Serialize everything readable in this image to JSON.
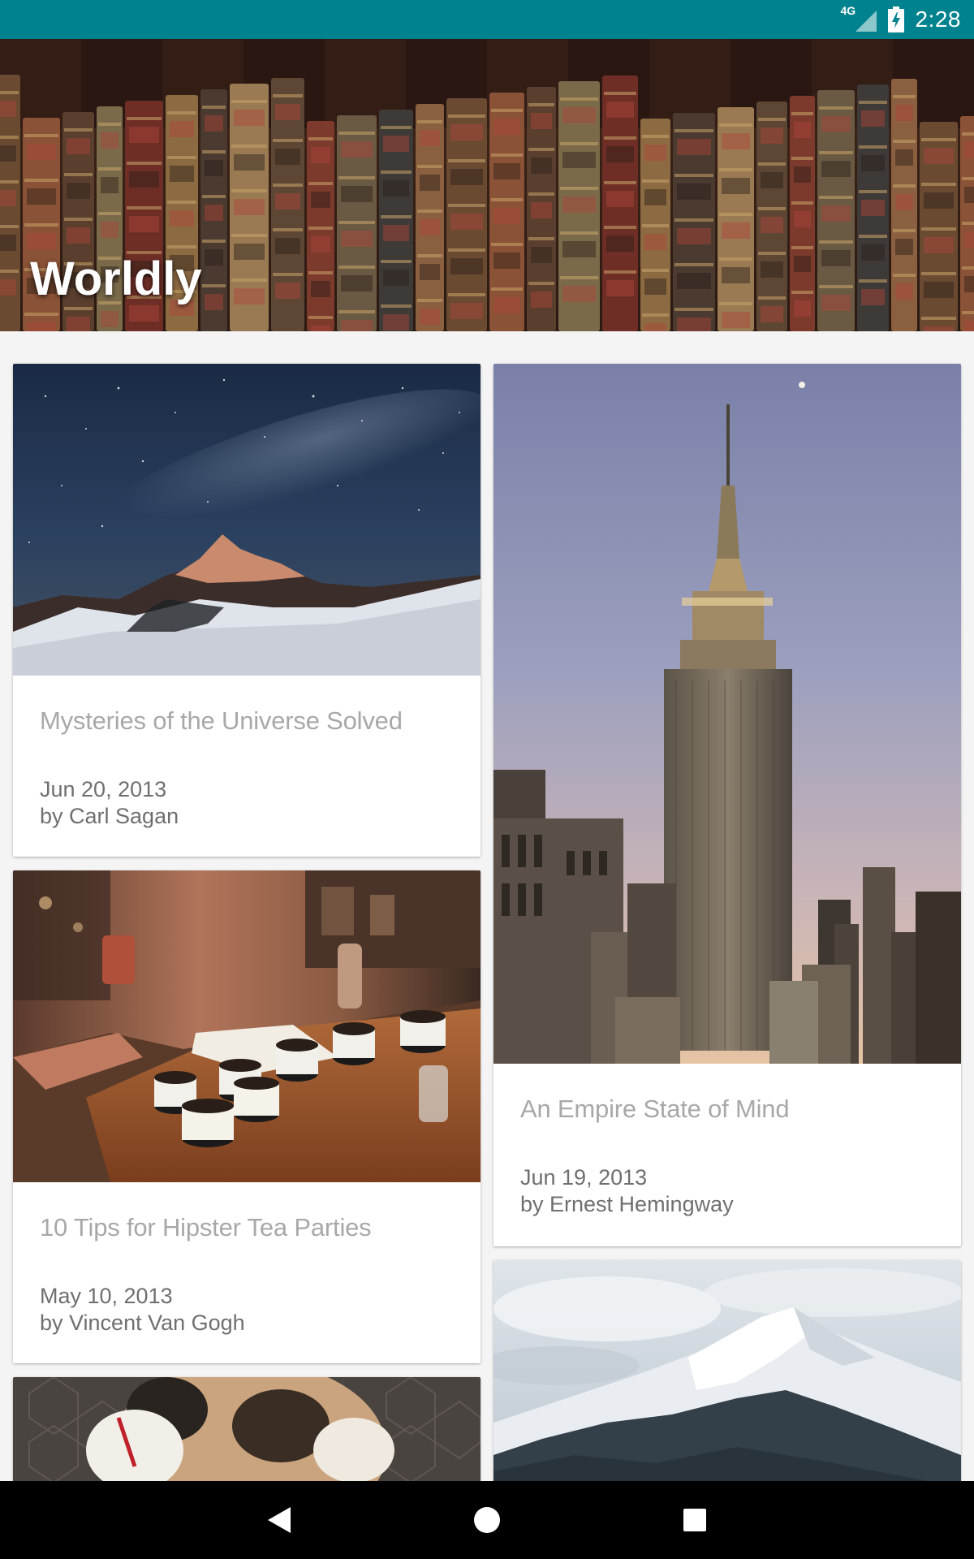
{
  "status_bar": {
    "network_label": "4G",
    "time": "2:28",
    "icons": [
      "signal-icon",
      "battery-charging-icon"
    ]
  },
  "header": {
    "title": "Worldly",
    "background": "bookshelf-image"
  },
  "articles": [
    {
      "title": "Mysteries of the Universe Solved",
      "date": "Jun 20, 2013",
      "author": "by Carl Sagan",
      "image": "night-sky-mountain-image"
    },
    {
      "title": "An Empire State of Mind",
      "date": "Jun 19, 2013",
      "author": "by Ernest Hemingway",
      "image": "empire-state-building-image"
    },
    {
      "title": "10 Tips for Hipster Tea Parties",
      "date": "May 10, 2013",
      "author": "by Vincent Van Gogh",
      "image": "tea-cups-table-image"
    },
    {
      "image": "bulldog-image"
    },
    {
      "image": "snowy-mountain-image"
    }
  ],
  "nav_bar": {
    "buttons": [
      "back-icon",
      "home-icon",
      "recents-icon"
    ]
  },
  "colors": {
    "status_bar": "#00838f",
    "background": "#f4f4f4",
    "card_title": "#a8a8a8",
    "card_meta": "#6f6f6f"
  }
}
